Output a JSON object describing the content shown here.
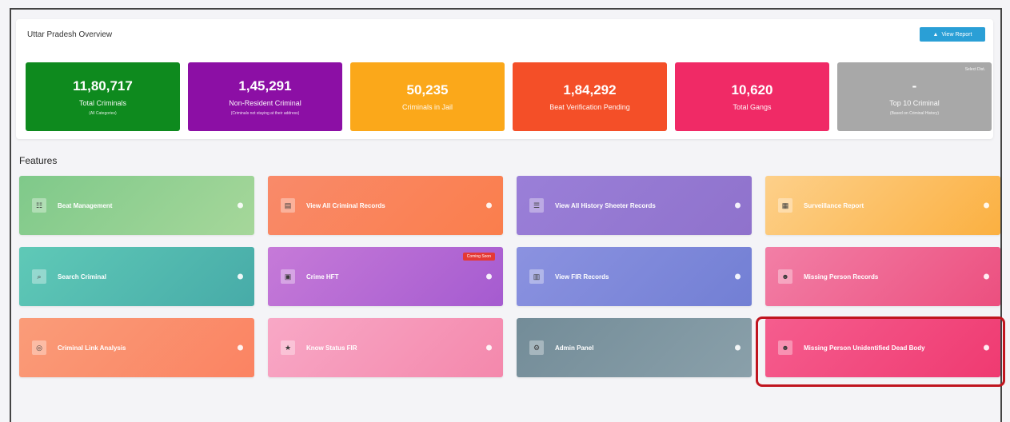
{
  "header": {
    "title": "Uttar Pradesh Overview",
    "view_report_label": "View Report",
    "view_report_icon": "user-icon"
  },
  "stats": [
    {
      "value": "11,80,717",
      "label": "Total Criminals",
      "sub": "(All Categories)",
      "color": "#0e8a1e"
    },
    {
      "value": "1,45,291",
      "label": "Non-Resident Criminal",
      "sub": "(Criminals not staying at their address)",
      "color": "#8c0fa5"
    },
    {
      "value": "50,235",
      "label": "Criminals in Jail",
      "sub": "",
      "color": "#fba81a"
    },
    {
      "value": "1,84,292",
      "label": "Beat Verification Pending",
      "sub": "",
      "color": "#f44f28"
    },
    {
      "value": "10,620",
      "label": "Total Gangs",
      "sub": "",
      "color": "#f02a66"
    },
    {
      "value": "-",
      "label": "Top 10 Criminal",
      "sub": "(Based on Criminal History)",
      "color": "#a8a8a8",
      "corner": "Select Dist."
    }
  ],
  "features": {
    "title": "Features",
    "tiles": [
      {
        "label": "Beat Management",
        "icon": "users-icon",
        "glyph": "☷",
        "g1": "#7fc98a",
        "g2": "#a6d79a"
      },
      {
        "label": "View All Criminal Records",
        "icon": "document-icon",
        "glyph": "▤",
        "g1": "#f98a6a",
        "g2": "#fa7e4c"
      },
      {
        "label": "View All History Sheeter Records",
        "icon": "list-icon",
        "glyph": "☰",
        "g1": "#9a7fd8",
        "g2": "#8f72cc"
      },
      {
        "label": "Surveillance Report",
        "icon": "report-icon",
        "glyph": "▦",
        "g1": "#fdd08a",
        "g2": "#fbb041"
      },
      {
        "label": "Search Criminal",
        "icon": "search-icon",
        "glyph": "⌕",
        "g1": "#5fc9b7",
        "g2": "#47aba8"
      },
      {
        "label": "Crime HFT",
        "icon": "folder-icon",
        "glyph": "▣",
        "g1": "#c67ad8",
        "g2": "#a55bd0",
        "badge": "Coming Soon"
      },
      {
        "label": "View FIR Records",
        "icon": "file-icon",
        "glyph": "▥",
        "g1": "#8b92e0",
        "g2": "#727fd4"
      },
      {
        "label": "Missing Person Records",
        "icon": "person-icon",
        "glyph": "☻",
        "g1": "#f27fa6",
        "g2": "#ec4f7f"
      },
      {
        "label": "Criminal Link Analysis",
        "icon": "network-icon",
        "glyph": "◎",
        "g1": "#fa9c79",
        "g2": "#fb8362"
      },
      {
        "label": "Know Status FIR",
        "icon": "star-icon",
        "glyph": "★",
        "g1": "#f8a8c6",
        "g2": "#f488ac"
      },
      {
        "label": "Admin Panel",
        "icon": "settings-icon",
        "glyph": "⚙",
        "g1": "#738c98",
        "g2": "#8aa0aa"
      },
      {
        "label": "Missing Person Unidentified Dead Body",
        "icon": "person-icon",
        "glyph": "☻",
        "g1": "#f55d8e",
        "g2": "#ef3a71"
      }
    ]
  }
}
